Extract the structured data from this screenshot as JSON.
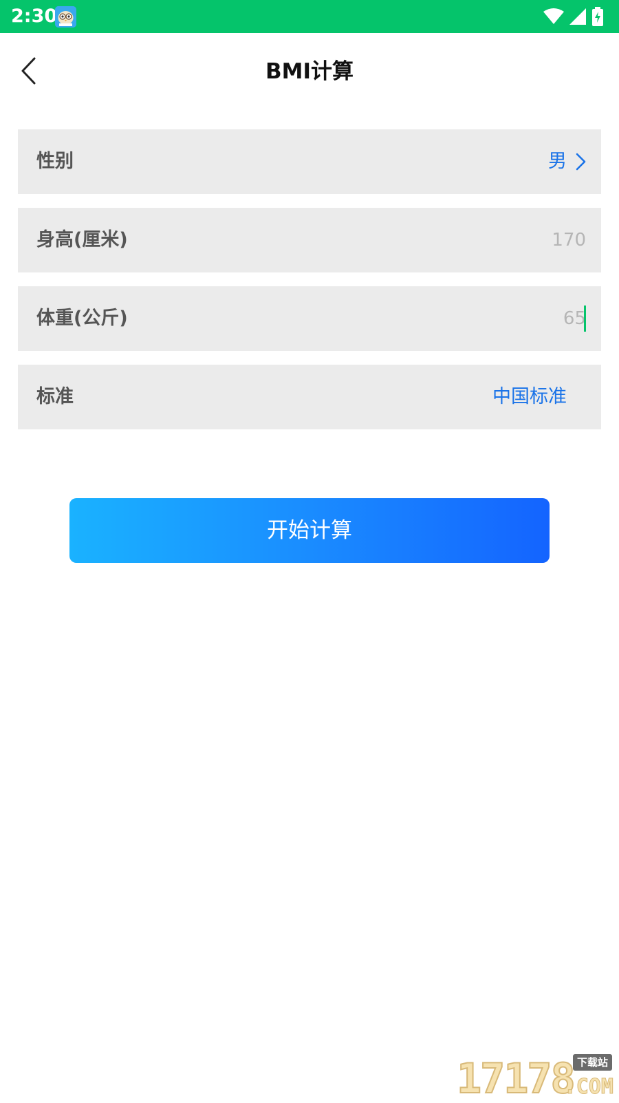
{
  "status_bar": {
    "time": "2:30",
    "app_icon": "owl-app-icon",
    "icons": [
      "wifi-icon",
      "cellular-signal-icon",
      "battery-charging-icon"
    ],
    "color": "#05c46b"
  },
  "nav": {
    "back_icon": "chevron-left-icon",
    "title": "BMI计算"
  },
  "form": {
    "gender": {
      "label": "性别",
      "value": "男",
      "icon": "chevron-right-icon"
    },
    "height": {
      "label": "身高(厘米)",
      "value": "",
      "placeholder": "170"
    },
    "weight": {
      "label": "体重(公斤)",
      "value": "",
      "placeholder": "65"
    },
    "standard": {
      "label": "标准",
      "value": "中国标准"
    }
  },
  "actions": {
    "calculate_label": "开始计算"
  },
  "watermark": {
    "digits": "17178",
    "badge": "下载站",
    "suffix": ".COM"
  },
  "colors": {
    "accent": "#1a73e8",
    "row_background": "#ebebeb",
    "button_gradient_start": "#1ab2ff",
    "button_gradient_end": "#1464ff"
  }
}
